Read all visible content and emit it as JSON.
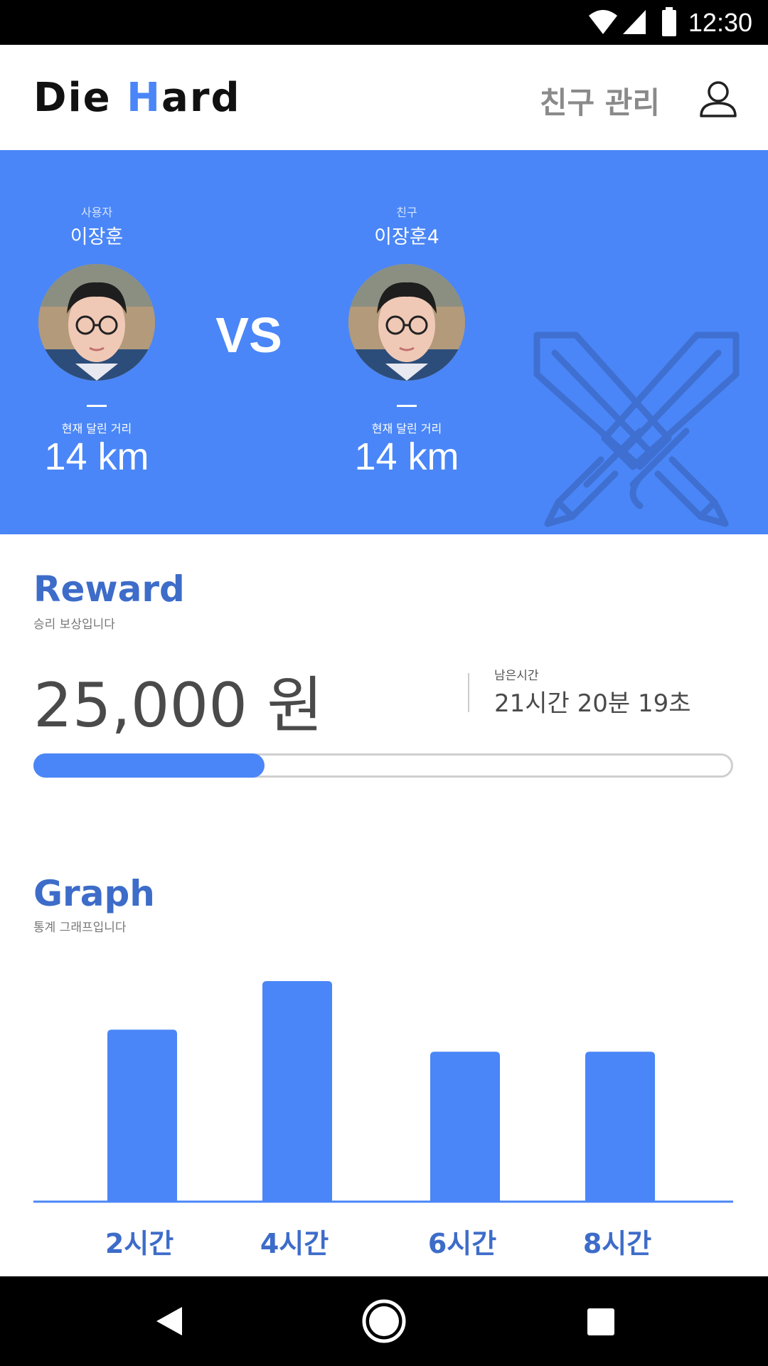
{
  "status_bar": {
    "time": "12:30"
  },
  "header": {
    "logo_part1": "Die ",
    "logo_h": "H",
    "logo_part2": "ard",
    "friend_manage": "친구 관리",
    "accent_color": "#4a86f7"
  },
  "versus": {
    "vs_text": "VS",
    "user": {
      "role": "사용자",
      "name": "이장훈",
      "distance_label": "현재 달린 거리",
      "distance": "14 km"
    },
    "friend": {
      "role": "친구",
      "name": "이장훈4",
      "distance_label": "현재 달린 거리",
      "distance": "14 km"
    },
    "background_color": "#4a86f7"
  },
  "reward": {
    "title": "Reward",
    "subtitle": "승리 보상입니다",
    "amount": "25,000 원",
    "remaining_label": "남은시간",
    "remaining_value": "21시간 20분 19초",
    "progress": 0.33
  },
  "graph": {
    "title": "Graph",
    "subtitle": "통계 그래프입니다"
  },
  "chart_data": {
    "type": "bar",
    "categories": [
      "2시간",
      "4시간",
      "6시간",
      "8시간"
    ],
    "values": [
      78,
      100,
      68,
      68
    ],
    "ylim": [
      0,
      100
    ],
    "grid": false,
    "color": "#4a86f7",
    "title": "",
    "xlabel": "",
    "ylabel": ""
  },
  "nav_bar": {
    "icons": [
      "back-triangle-icon",
      "home-circle-icon",
      "recents-square-icon"
    ]
  }
}
